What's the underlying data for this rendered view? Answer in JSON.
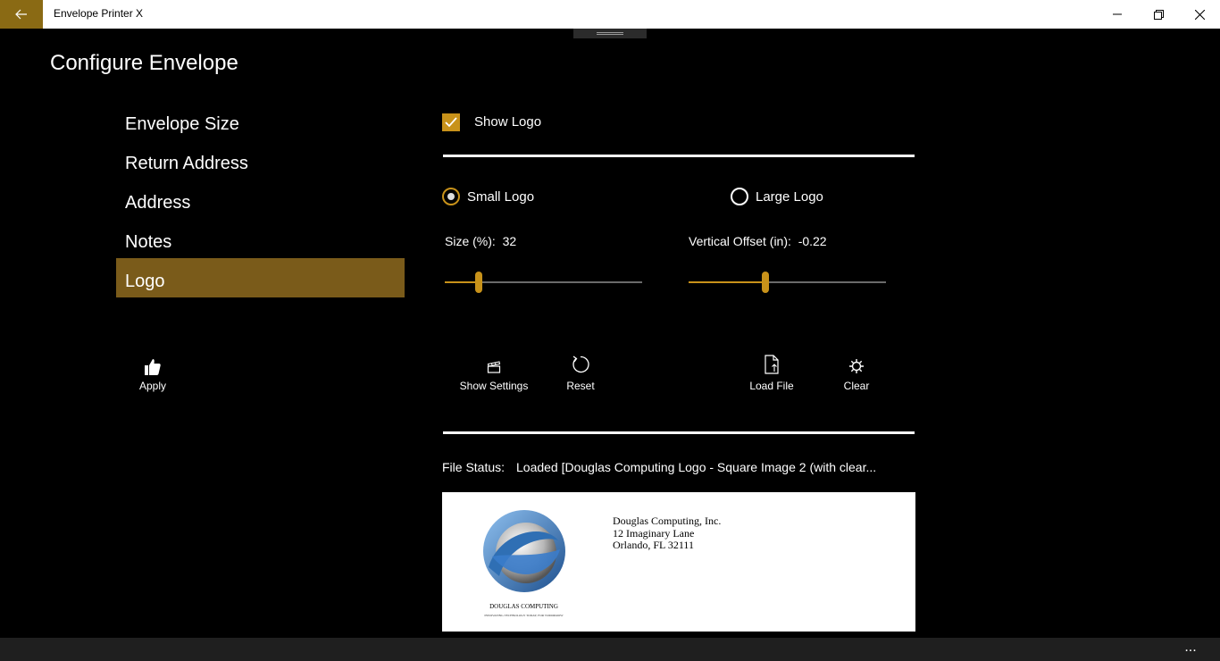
{
  "window": {
    "title": "Envelope Printer X",
    "accent": "#8a6a14"
  },
  "page": {
    "title": "Configure Envelope"
  },
  "nav": {
    "items": [
      {
        "label": "Envelope Size"
      },
      {
        "label": "Return Address"
      },
      {
        "label": "Address"
      },
      {
        "label": "Notes"
      },
      {
        "label": "Logo",
        "selected": true
      }
    ]
  },
  "apply": {
    "label": "Apply",
    "icon": "thumbs-up-icon"
  },
  "logo": {
    "show_logo_label": "Show Logo",
    "show_logo_checked": true,
    "small_logo_label": "Small Logo",
    "large_logo_label": "Large Logo",
    "selected_size": "small",
    "size_label": "Size (%):",
    "size_value": "32",
    "size_fraction": 0.17,
    "offset_label": "Vertical Offset (in):",
    "offset_value": "-0.22",
    "offset_fraction": 0.39
  },
  "commands": {
    "show_settings": "Show Settings",
    "reset": "Reset",
    "load_file": "Load File",
    "clear": "Clear"
  },
  "file_status": {
    "label": "File Status:",
    "value": "Loaded [Douglas Computing Logo - Square Image 2 (with clear..."
  },
  "preview": {
    "logo_text": "DOUGLAS COMPUTING",
    "logo_tagline": "INNOVATING TECHNOLOGY TODAY, FOR TOMORROW",
    "address_lines": [
      "Douglas Computing, Inc.",
      "12 Imaginary Lane",
      "Orlando, FL 32111"
    ]
  },
  "bottombar": {
    "more_label": "..."
  },
  "colors": {
    "accent": "#c8921a",
    "nav_selected": "#7a5b1a"
  }
}
